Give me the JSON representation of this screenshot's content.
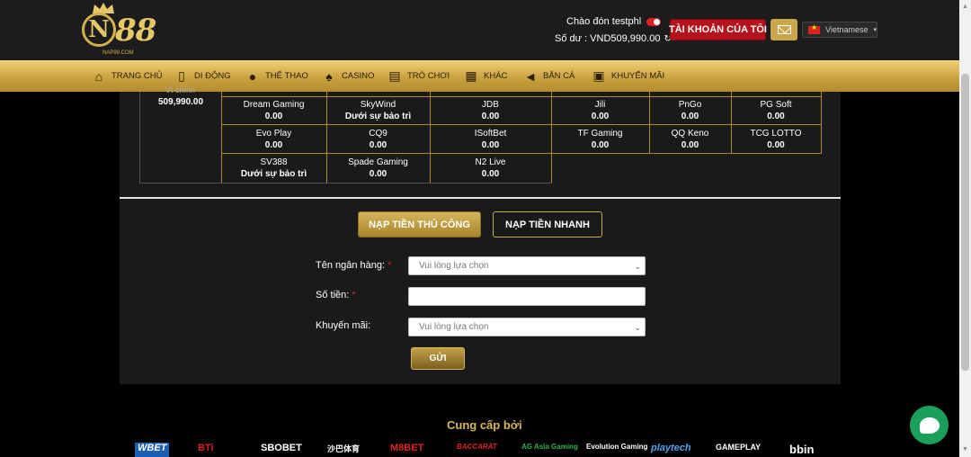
{
  "header": {
    "logo_text": "N88",
    "logo_domain": "NAP99.COM",
    "greeting": "Chào đón testphl",
    "balance_label": "Số dư : VND509,990.00",
    "account_button": "TÀI KHOẢN CỦA TÔI",
    "language": "Vietnamese"
  },
  "nav": [
    {
      "label": "TRANG CHỦ",
      "icon": "home-icon"
    },
    {
      "label": "DI ĐỘNG",
      "icon": "mobile-icon"
    },
    {
      "label": "THỂ THAO",
      "icon": "soccer-ball-icon"
    },
    {
      "label": "CASINO",
      "icon": "cards-icon"
    },
    {
      "label": "TRÒ CHƠI",
      "icon": "slot-machine-icon"
    },
    {
      "label": "KHÁC",
      "icon": "grid-icon"
    },
    {
      "label": "BẮN CÁ",
      "icon": "fish-icon"
    },
    {
      "label": "KHUYẾN MÃI",
      "icon": "gift-icon"
    }
  ],
  "wallet": {
    "label": "Ví chính",
    "value": "509,990.00"
  },
  "providers": [
    {
      "name": "Dream Gaming",
      "value": "0.00"
    },
    {
      "name": "SkyWind",
      "value": "Dưới sự bảo trì"
    },
    {
      "name": "JDB",
      "value": "0.00"
    },
    {
      "name": "Jili",
      "value": "0.00"
    },
    {
      "name": "PnGo",
      "value": "0.00"
    },
    {
      "name": "PG Soft",
      "value": "0.00"
    },
    {
      "name": "Evo Play",
      "value": "0.00"
    },
    {
      "name": "CQ9",
      "value": "0.00"
    },
    {
      "name": "ISoftBet",
      "value": "0.00"
    },
    {
      "name": "TF Gaming",
      "value": "0.00"
    },
    {
      "name": "QQ Keno",
      "value": "0.00"
    },
    {
      "name": "TCG LOTTO",
      "value": "0.00"
    },
    {
      "name": "SV388",
      "value": "Dưới sự bảo trì"
    },
    {
      "name": "Spade Gaming",
      "value": "0.00"
    },
    {
      "name": "N2 Live",
      "value": "0.00"
    }
  ],
  "deposit_tabs": {
    "manual": "NẠP TIỀN THỦ CÔNG",
    "fast": "NẠP TIỀN NHANH"
  },
  "form": {
    "bank_label": "Tên ngân hàng:",
    "bank_placeholder": "Vui lòng lựa chọn",
    "amount_label": "Số tiền:",
    "amount_value": "",
    "promo_label": "Khuyến mãi:",
    "promo_placeholder": "Vui lòng lựa chọn",
    "submit": "GỬI"
  },
  "footer": {
    "providers_title": "Cung cấp bởi",
    "logos": [
      "WBET",
      "BTi",
      "SBOBET",
      "沙巴体育",
      "M8BET",
      "BACCARAT",
      "AG Asia Gaming",
      "Evolution Gaming",
      "playtech",
      "GAMEPLAY",
      "bbin"
    ]
  },
  "colors": {
    "gold": "#c9a74a",
    "account_red": "#b5121b",
    "chat_green": "#1aa05a"
  }
}
